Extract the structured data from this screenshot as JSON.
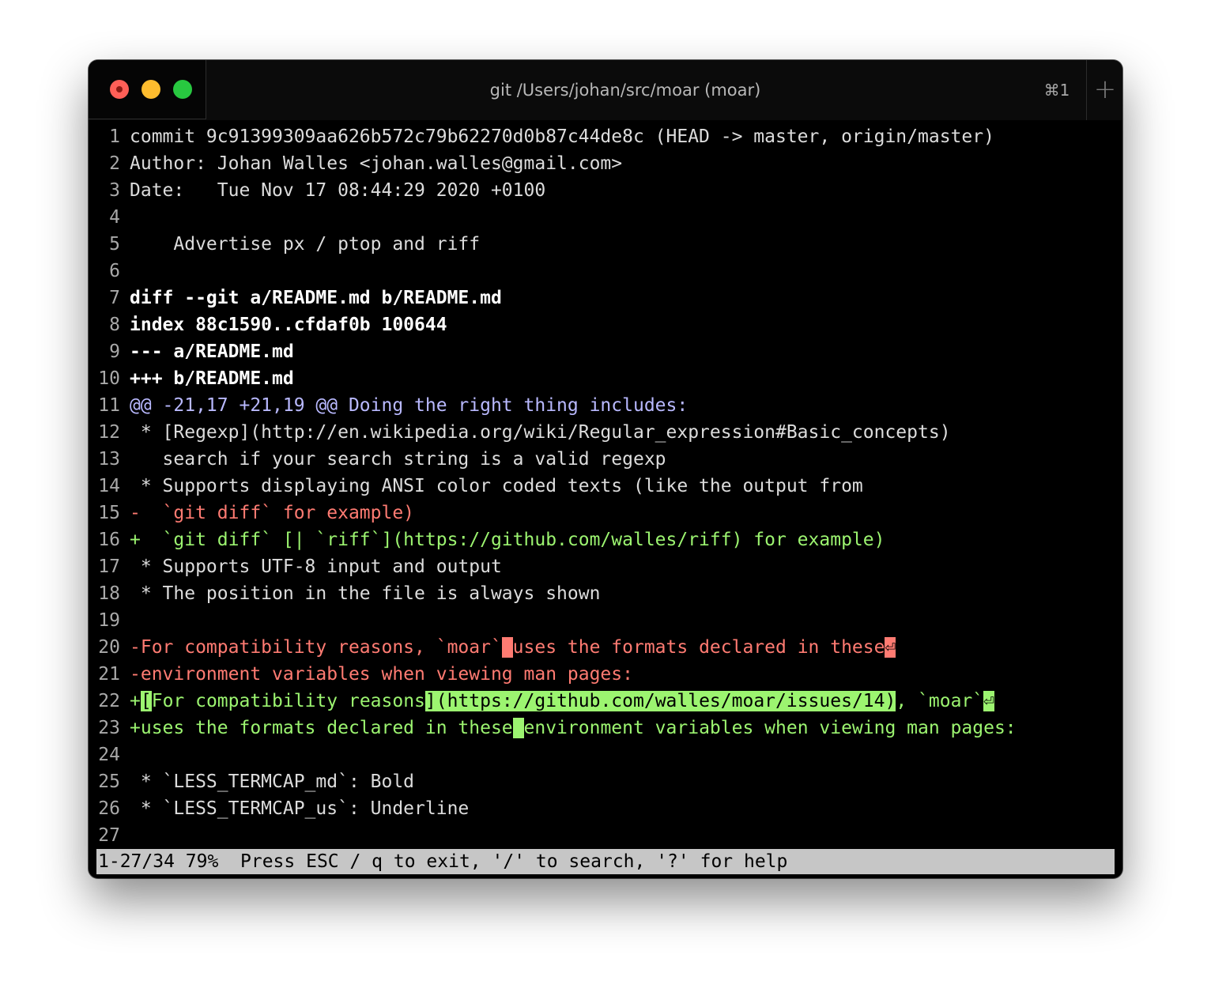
{
  "window": {
    "title": "git /Users/johan/src/moar (moar)",
    "shortcut": "⌘1",
    "new_tab_icon": "+"
  },
  "lines": [
    {
      "n": "1",
      "parts": [
        {
          "t": "commit 9c91399309aa626b572c79b62270d0b87c44de8c (HEAD -> master, origin/master)",
          "c": "txt"
        }
      ]
    },
    {
      "n": "2",
      "parts": [
        {
          "t": "Author: Johan Walles <johan.walles@gmail.com>",
          "c": "txt"
        }
      ]
    },
    {
      "n": "3",
      "parts": [
        {
          "t": "Date:   Tue Nov 17 08:44:29 2020 +0100",
          "c": "txt"
        }
      ]
    },
    {
      "n": "4",
      "parts": [
        {
          "t": "",
          "c": "txt"
        }
      ]
    },
    {
      "n": "5",
      "parts": [
        {
          "t": "    Advertise px / ptop and riff",
          "c": "txt"
        }
      ]
    },
    {
      "n": "6",
      "parts": [
        {
          "t": "",
          "c": "txt"
        }
      ]
    },
    {
      "n": "7",
      "parts": [
        {
          "t": "diff --git a/README.md b/README.md",
          "c": "bold"
        }
      ]
    },
    {
      "n": "8",
      "parts": [
        {
          "t": "index 88c1590..cfdaf0b 100644",
          "c": "bold"
        }
      ]
    },
    {
      "n": "9",
      "parts": [
        {
          "t": "--- a/README.md",
          "c": "bold"
        }
      ]
    },
    {
      "n": "10",
      "parts": [
        {
          "t": "+++ b/README.md",
          "c": "bold"
        }
      ]
    },
    {
      "n": "11",
      "parts": [
        {
          "t": "@@ -21,17 +21,19 @@ Doing the right thing includes:",
          "c": "hunk"
        }
      ]
    },
    {
      "n": "12",
      "parts": [
        {
          "t": " * [Regexp](http://en.wikipedia.org/wiki/Regular_expression#Basic_concepts)",
          "c": "txt"
        }
      ]
    },
    {
      "n": "13",
      "parts": [
        {
          "t": "   search if your search string is a valid regexp",
          "c": "txt"
        }
      ]
    },
    {
      "n": "14",
      "parts": [
        {
          "t": " * Supports displaying ANSI color coded texts (like the output from",
          "c": "txt"
        }
      ]
    },
    {
      "n": "15",
      "parts": [
        {
          "t": "-  `git diff` for example)",
          "c": "del"
        }
      ]
    },
    {
      "n": "16",
      "parts": [
        {
          "t": "+  `git diff` [| `riff`](https://github.com/walles/riff) for example)",
          "c": "add"
        }
      ]
    },
    {
      "n": "17",
      "parts": [
        {
          "t": " * Supports UTF-8 input and output",
          "c": "txt"
        }
      ]
    },
    {
      "n": "18",
      "parts": [
        {
          "t": " * The position in the file is always shown",
          "c": "txt"
        }
      ]
    },
    {
      "n": "19",
      "parts": [
        {
          "t": "",
          "c": "txt"
        }
      ]
    },
    {
      "n": "20",
      "parts": [
        {
          "t": "-For compatibility reasons, `moar`",
          "c": "del"
        },
        {
          "t": " ",
          "c": "del-hl"
        },
        {
          "t": "uses the formats declared in these",
          "c": "del"
        },
        {
          "t": "⏎",
          "c": "del-hl"
        }
      ]
    },
    {
      "n": "21",
      "parts": [
        {
          "t": "-environment variables when viewing man pages:",
          "c": "del"
        }
      ]
    },
    {
      "n": "22",
      "parts": [
        {
          "t": "+",
          "c": "add"
        },
        {
          "t": "[",
          "c": "add-hl"
        },
        {
          "t": "For compatibility reasons",
          "c": "add"
        },
        {
          "t": "](https://github.com/walles/moar/issues/14)",
          "c": "add-hl"
        },
        {
          "t": ", `moar`",
          "c": "add"
        },
        {
          "t": "⏎",
          "c": "add-hl"
        }
      ]
    },
    {
      "n": "23",
      "parts": [
        {
          "t": "+uses the formats declared in these",
          "c": "add"
        },
        {
          "t": " ",
          "c": "add-hl"
        },
        {
          "t": "environment variables when viewing man pages:",
          "c": "add"
        }
      ]
    },
    {
      "n": "24",
      "parts": [
        {
          "t": "",
          "c": "txt"
        }
      ]
    },
    {
      "n": "25",
      "parts": [
        {
          "t": " * `LESS_TERMCAP_md`: Bold",
          "c": "txt"
        }
      ]
    },
    {
      "n": "26",
      "parts": [
        {
          "t": " * `LESS_TERMCAP_us`: Underline",
          "c": "txt"
        }
      ]
    },
    {
      "n": "27",
      "parts": [
        {
          "t": "",
          "c": "txt"
        }
      ]
    }
  ],
  "status": {
    "text": "1-27/34 79%  Press ESC / q to exit, '/' to search, '?' for help"
  }
}
